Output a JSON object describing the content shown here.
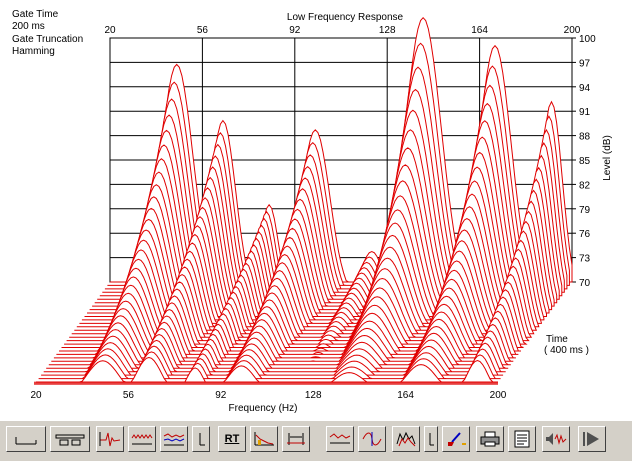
{
  "chart_data": {
    "type": "waterfall",
    "title": "Low Frequency Response",
    "xlabel": "Frequency (Hz)",
    "ylabel": "Level (dB)",
    "zlabel": "Time",
    "z_range_label": "( 400 ms )",
    "x_ticks": [
      "20",
      "56",
      "92",
      "128",
      "164",
      "200"
    ],
    "y_ticks": [
      "100",
      "97",
      "94",
      "91",
      "88",
      "85",
      "82",
      "79",
      "76",
      "73",
      "70"
    ],
    "xlim": [
      20,
      200
    ],
    "ylim": [
      70,
      100
    ],
    "zlim_ms": [
      0,
      400
    ],
    "slice_count": 30,
    "line_color": "#e00000",
    "first_slice_peaks": [
      {
        "freq": 46,
        "level": 95
      },
      {
        "freq": 64,
        "level": 89
      },
      {
        "freq": 82,
        "level": 80
      },
      {
        "freq": 100,
        "level": 88
      },
      {
        "freq": 122,
        "level": 75
      },
      {
        "freq": 142,
        "level": 100
      },
      {
        "freq": 170,
        "level": 97
      },
      {
        "freq": 192,
        "level": 91
      }
    ]
  },
  "info": {
    "gate_time_label": "Gate Time",
    "gate_time_value": "200 ms",
    "gate_truncation_label": "Gate Truncation",
    "gate_truncation_value": "Hamming"
  },
  "toolbar": {
    "rt_label": "RT"
  }
}
